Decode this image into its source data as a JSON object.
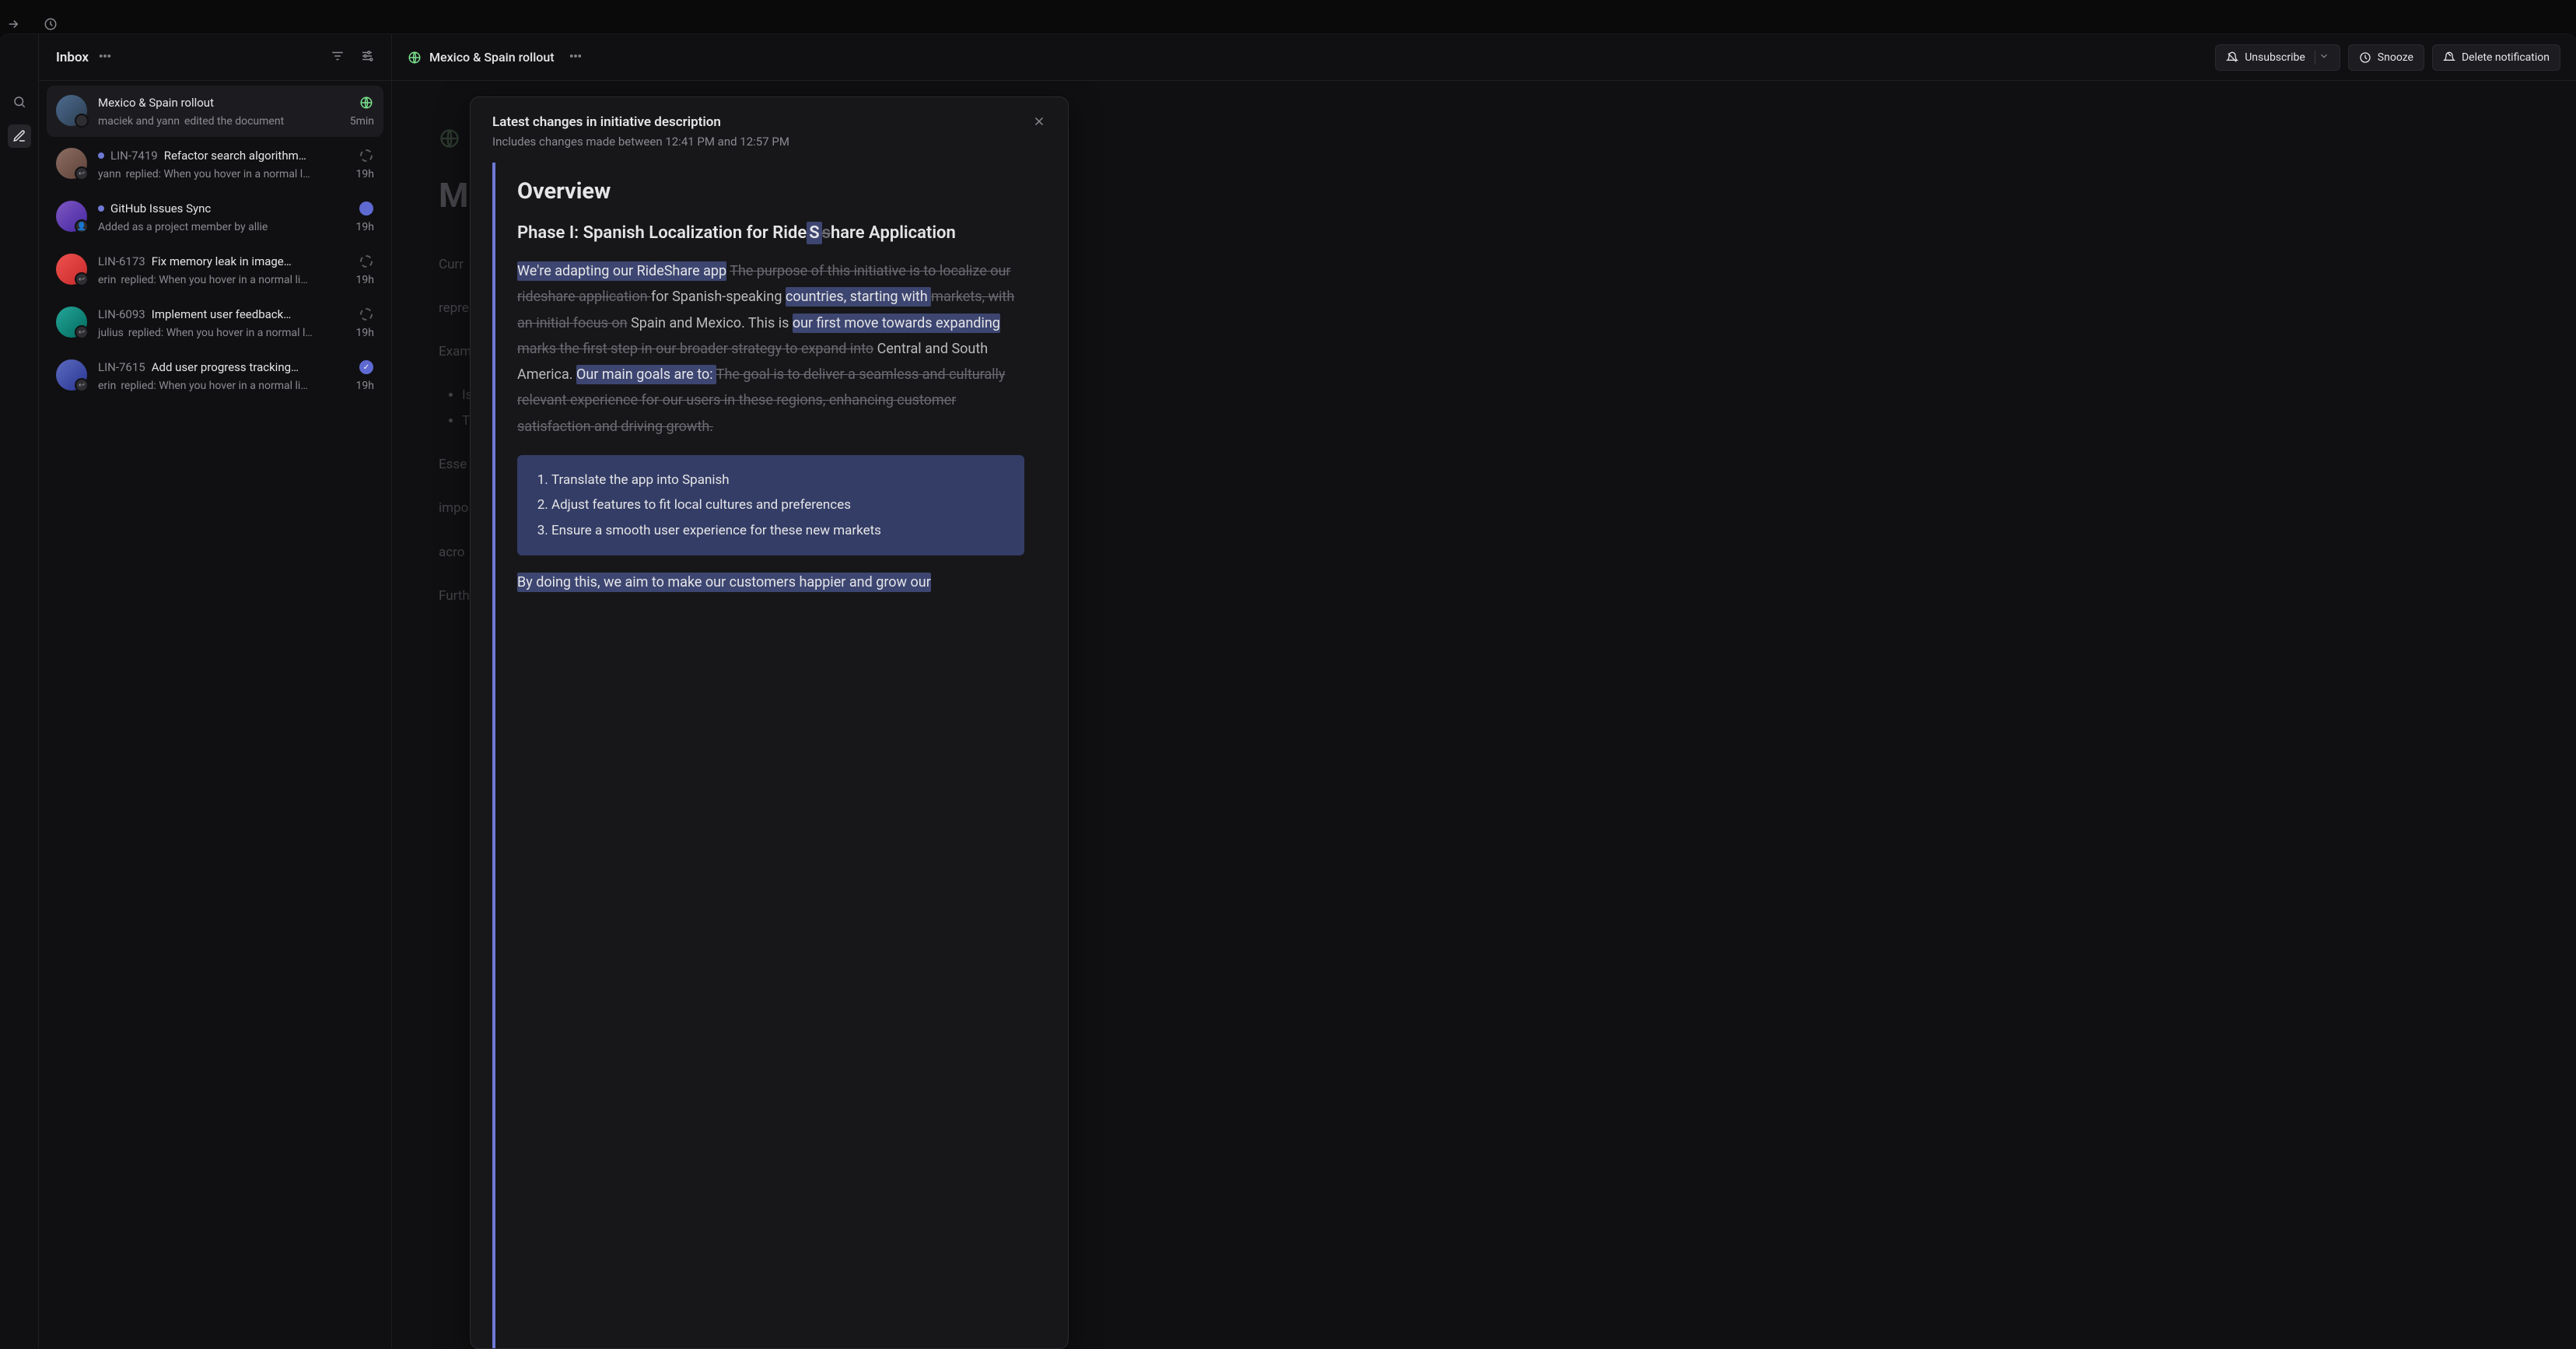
{
  "inbox": {
    "title": "Inbox",
    "items": [
      {
        "title": "Mexico & Spain rollout",
        "actors": "maciek and yann",
        "event": "edited the document",
        "time": "5min",
        "marker": "globe",
        "avatar": "a1",
        "selected": true
      },
      {
        "id": "LIN-7419",
        "title": "Refactor search algorithm…",
        "actors": "yann",
        "event": "replied: When you hover in a normal l…",
        "time": "19h",
        "marker": "dash",
        "avatar": "a2",
        "unread": true
      },
      {
        "title": "GitHub Issues Sync",
        "actors": "",
        "event": "Added as a project member by allie",
        "time": "19h",
        "marker": "gh",
        "avatar": "a3",
        "unread": true
      },
      {
        "id": "LIN-6173",
        "title": "Fix memory leak in image…",
        "actors": "erin",
        "event": "replied: When you hover in a normal li…",
        "time": "19h",
        "marker": "dash",
        "avatar": "a4"
      },
      {
        "id": "LIN-6093",
        "title": "Implement user feedback…",
        "actors": "julius",
        "event": "replied: When you hover in a normal l…",
        "time": "19h",
        "marker": "dash",
        "avatar": "a5"
      },
      {
        "id": "LIN-7615",
        "title": "Add user progress tracking…",
        "actors": "erin",
        "event": "replied: When you hover in a normal li…",
        "time": "19h",
        "marker": "check",
        "avatar": "a6"
      }
    ]
  },
  "main": {
    "title": "Mexico & Spain rollout",
    "actions": {
      "unsubscribe": "Unsubscribe",
      "snooze": "Snooze",
      "delete": "Delete notification"
    }
  },
  "back": {
    "heading": "Me",
    "p1": "Curr",
    "p2": "repre",
    "p3": "Exam",
    "li1": "Is",
    "li2": "T",
    "p4": "Esse",
    "p5": "impo",
    "p6": "acro",
    "p7": "Furth"
  },
  "diff": {
    "header_title": "Latest changes in initiative description",
    "header_sub": "Includes changes made between 12:41 PM and 12:57 PM",
    "overview": "Overview",
    "phase_title_pre": "Phase I: Spanish Localization for Ride",
    "phase_title_s": "S",
    "phase_title_strike_s": "s",
    "phase_title_post": "hare Application",
    "body": {
      "s1_hl": "We're adapting our RideShare app",
      "s1_strike": " The purpose of this initiative is to localize our rideshare application ",
      "s2_plain": "for Spanish-speaking",
      "s2_hl": " countries, starting with ",
      "s2_strike": "markets, with an initial focus on",
      "s3_plain": " Spain and Mexico. This is ",
      "s3_hl": "our first move towards expanding",
      "s3_strike": " marks the first step in our broader strategy to expand into",
      "s4_plain": " Central and South America.",
      "s4_hl": " Our main goals are to: ",
      "s4_strike": "The goal is to deliver a seamless and culturally relevant experience for our users in these regions, enhancing customer satisfaction and driving growth."
    },
    "list": [
      "Translate the app into Spanish",
      "Adjust features to fit local cultures and preferences",
      "Ensure a smooth user experience for these new markets"
    ],
    "trailing": "By doing this, we aim to make our customers happier and grow our"
  }
}
